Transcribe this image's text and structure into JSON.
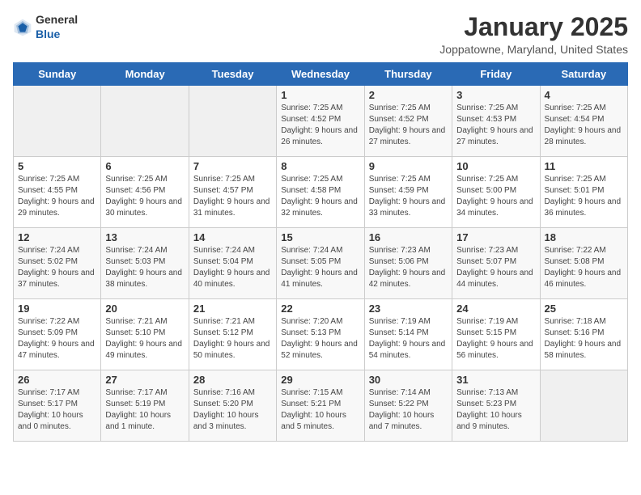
{
  "header": {
    "logo_general": "General",
    "logo_blue": "Blue",
    "title": "January 2025",
    "subtitle": "Joppatowne, Maryland, United States"
  },
  "weekdays": [
    "Sunday",
    "Monday",
    "Tuesday",
    "Wednesday",
    "Thursday",
    "Friday",
    "Saturday"
  ],
  "weeks": [
    [
      {
        "day": "",
        "sunrise": "",
        "sunset": "",
        "daylight": "",
        "empty": true
      },
      {
        "day": "",
        "sunrise": "",
        "sunset": "",
        "daylight": "",
        "empty": true
      },
      {
        "day": "",
        "sunrise": "",
        "sunset": "",
        "daylight": "",
        "empty": true
      },
      {
        "day": "1",
        "sunrise": "Sunrise: 7:25 AM",
        "sunset": "Sunset: 4:52 PM",
        "daylight": "Daylight: 9 hours and 26 minutes."
      },
      {
        "day": "2",
        "sunrise": "Sunrise: 7:25 AM",
        "sunset": "Sunset: 4:52 PM",
        "daylight": "Daylight: 9 hours and 27 minutes."
      },
      {
        "day": "3",
        "sunrise": "Sunrise: 7:25 AM",
        "sunset": "Sunset: 4:53 PM",
        "daylight": "Daylight: 9 hours and 27 minutes."
      },
      {
        "day": "4",
        "sunrise": "Sunrise: 7:25 AM",
        "sunset": "Sunset: 4:54 PM",
        "daylight": "Daylight: 9 hours and 28 minutes."
      }
    ],
    [
      {
        "day": "5",
        "sunrise": "Sunrise: 7:25 AM",
        "sunset": "Sunset: 4:55 PM",
        "daylight": "Daylight: 9 hours and 29 minutes."
      },
      {
        "day": "6",
        "sunrise": "Sunrise: 7:25 AM",
        "sunset": "Sunset: 4:56 PM",
        "daylight": "Daylight: 9 hours and 30 minutes."
      },
      {
        "day": "7",
        "sunrise": "Sunrise: 7:25 AM",
        "sunset": "Sunset: 4:57 PM",
        "daylight": "Daylight: 9 hours and 31 minutes."
      },
      {
        "day": "8",
        "sunrise": "Sunrise: 7:25 AM",
        "sunset": "Sunset: 4:58 PM",
        "daylight": "Daylight: 9 hours and 32 minutes."
      },
      {
        "day": "9",
        "sunrise": "Sunrise: 7:25 AM",
        "sunset": "Sunset: 4:59 PM",
        "daylight": "Daylight: 9 hours and 33 minutes."
      },
      {
        "day": "10",
        "sunrise": "Sunrise: 7:25 AM",
        "sunset": "Sunset: 5:00 PM",
        "daylight": "Daylight: 9 hours and 34 minutes."
      },
      {
        "day": "11",
        "sunrise": "Sunrise: 7:25 AM",
        "sunset": "Sunset: 5:01 PM",
        "daylight": "Daylight: 9 hours and 36 minutes."
      }
    ],
    [
      {
        "day": "12",
        "sunrise": "Sunrise: 7:24 AM",
        "sunset": "Sunset: 5:02 PM",
        "daylight": "Daylight: 9 hours and 37 minutes."
      },
      {
        "day": "13",
        "sunrise": "Sunrise: 7:24 AM",
        "sunset": "Sunset: 5:03 PM",
        "daylight": "Daylight: 9 hours and 38 minutes."
      },
      {
        "day": "14",
        "sunrise": "Sunrise: 7:24 AM",
        "sunset": "Sunset: 5:04 PM",
        "daylight": "Daylight: 9 hours and 40 minutes."
      },
      {
        "day": "15",
        "sunrise": "Sunrise: 7:24 AM",
        "sunset": "Sunset: 5:05 PM",
        "daylight": "Daylight: 9 hours and 41 minutes."
      },
      {
        "day": "16",
        "sunrise": "Sunrise: 7:23 AM",
        "sunset": "Sunset: 5:06 PM",
        "daylight": "Daylight: 9 hours and 42 minutes."
      },
      {
        "day": "17",
        "sunrise": "Sunrise: 7:23 AM",
        "sunset": "Sunset: 5:07 PM",
        "daylight": "Daylight: 9 hours and 44 minutes."
      },
      {
        "day": "18",
        "sunrise": "Sunrise: 7:22 AM",
        "sunset": "Sunset: 5:08 PM",
        "daylight": "Daylight: 9 hours and 46 minutes."
      }
    ],
    [
      {
        "day": "19",
        "sunrise": "Sunrise: 7:22 AM",
        "sunset": "Sunset: 5:09 PM",
        "daylight": "Daylight: 9 hours and 47 minutes."
      },
      {
        "day": "20",
        "sunrise": "Sunrise: 7:21 AM",
        "sunset": "Sunset: 5:10 PM",
        "daylight": "Daylight: 9 hours and 49 minutes."
      },
      {
        "day": "21",
        "sunrise": "Sunrise: 7:21 AM",
        "sunset": "Sunset: 5:12 PM",
        "daylight": "Daylight: 9 hours and 50 minutes."
      },
      {
        "day": "22",
        "sunrise": "Sunrise: 7:20 AM",
        "sunset": "Sunset: 5:13 PM",
        "daylight": "Daylight: 9 hours and 52 minutes."
      },
      {
        "day": "23",
        "sunrise": "Sunrise: 7:19 AM",
        "sunset": "Sunset: 5:14 PM",
        "daylight": "Daylight: 9 hours and 54 minutes."
      },
      {
        "day": "24",
        "sunrise": "Sunrise: 7:19 AM",
        "sunset": "Sunset: 5:15 PM",
        "daylight": "Daylight: 9 hours and 56 minutes."
      },
      {
        "day": "25",
        "sunrise": "Sunrise: 7:18 AM",
        "sunset": "Sunset: 5:16 PM",
        "daylight": "Daylight: 9 hours and 58 minutes."
      }
    ],
    [
      {
        "day": "26",
        "sunrise": "Sunrise: 7:17 AM",
        "sunset": "Sunset: 5:17 PM",
        "daylight": "Daylight: 10 hours and 0 minutes."
      },
      {
        "day": "27",
        "sunrise": "Sunrise: 7:17 AM",
        "sunset": "Sunset: 5:19 PM",
        "daylight": "Daylight: 10 hours and 1 minute."
      },
      {
        "day": "28",
        "sunrise": "Sunrise: 7:16 AM",
        "sunset": "Sunset: 5:20 PM",
        "daylight": "Daylight: 10 hours and 3 minutes."
      },
      {
        "day": "29",
        "sunrise": "Sunrise: 7:15 AM",
        "sunset": "Sunset: 5:21 PM",
        "daylight": "Daylight: 10 hours and 5 minutes."
      },
      {
        "day": "30",
        "sunrise": "Sunrise: 7:14 AM",
        "sunset": "Sunset: 5:22 PM",
        "daylight": "Daylight: 10 hours and 7 minutes."
      },
      {
        "day": "31",
        "sunrise": "Sunrise: 7:13 AM",
        "sunset": "Sunset: 5:23 PM",
        "daylight": "Daylight: 10 hours and 9 minutes."
      },
      {
        "day": "",
        "sunrise": "",
        "sunset": "",
        "daylight": "",
        "empty": true
      }
    ]
  ]
}
